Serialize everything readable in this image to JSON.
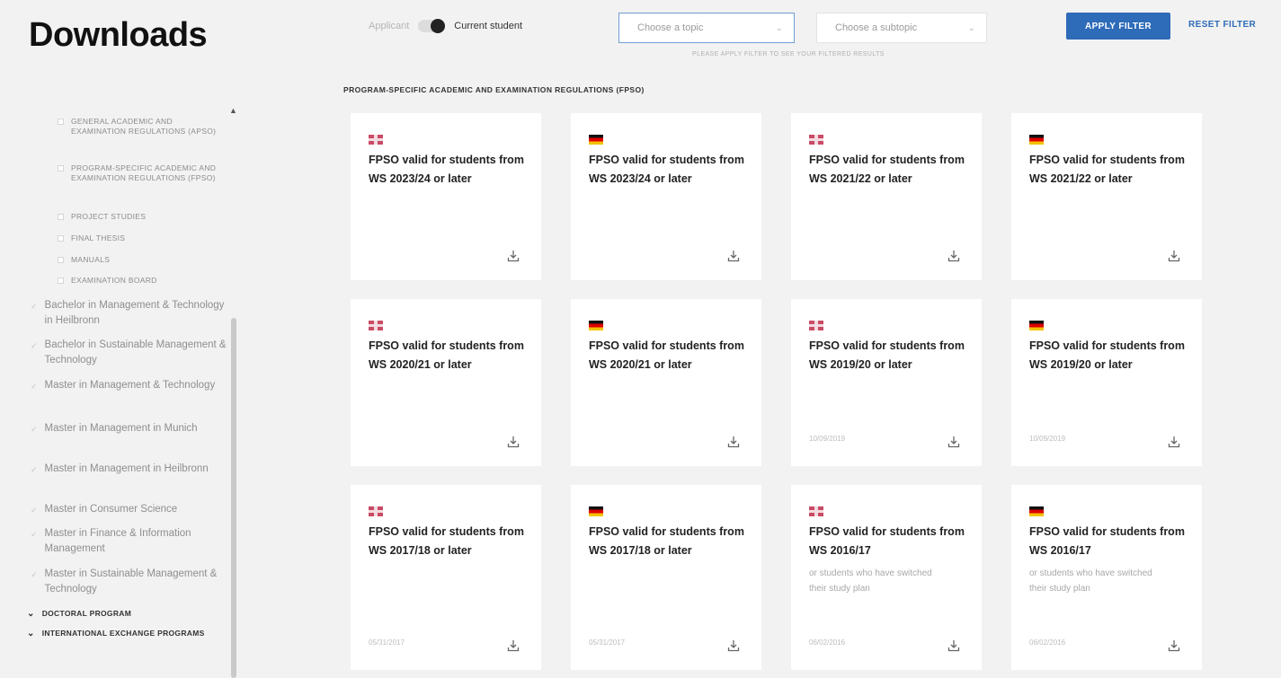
{
  "page": {
    "title": "Downloads"
  },
  "filters": {
    "status_option_off": "Applicant",
    "status_option_on": "Current student",
    "topic_placeholder": "Choose a topic",
    "subtopic_placeholder": "Choose a subtopic",
    "hint": "PLEASE APPLY FILTER TO SEE YOUR FILTERED RESULTS",
    "apply_label": "APPLY FILTER",
    "reset_label": "RESET FILTER"
  },
  "sidebar": {
    "sub_items": [
      {
        "label": "GENERAL ACADEMIC AND EXAMINATION REGULATIONS (APSO)"
      },
      {
        "label": "PROGRAM-SPECIFIC ACADEMIC AND EXAMINATION REGULATIONS (FPSO)"
      },
      {
        "label": "PROJECT STUDIES"
      },
      {
        "label": "FINAL THESIS"
      },
      {
        "label": "MANUALS"
      },
      {
        "label": "EXAMINATION BOARD"
      }
    ],
    "programs": [
      {
        "label": "Bachelor in Management & Technology in Heilbronn"
      },
      {
        "label": "Bachelor in Sustainable Management & Technology"
      },
      {
        "label": "Master in Management & Technology"
      },
      {
        "label": "Master in Management in Munich"
      },
      {
        "label": "Master in Management in Heilbronn"
      },
      {
        "label": "Master in Consumer Science"
      },
      {
        "label": "Master in Finance & Information Management"
      },
      {
        "label": "Master in Sustainable Management & Technology"
      }
    ],
    "sections": [
      {
        "label": "DOCTORAL PROGRAM"
      },
      {
        "label": "INTERNATIONAL EXCHANGE PROGRAMS"
      }
    ]
  },
  "main": {
    "section_heading": "PROGRAM-SPECIFIC ACADEMIC AND EXAMINATION REGULATIONS (FPSO)",
    "cards": [
      {
        "flag": "uk-flag",
        "title": "FPSO valid for students from WS 2023/24 or later",
        "note": "",
        "date": ""
      },
      {
        "flag": "german-flag",
        "title": "FPSO valid for students from WS 2023/24 or later",
        "note": "",
        "date": ""
      },
      {
        "flag": "uk-flag",
        "title": "FPSO valid for students from WS 2021/22 or later",
        "note": "",
        "date": ""
      },
      {
        "flag": "german-flag",
        "title": "FPSO valid for students from WS 2021/22 or later",
        "note": "",
        "date": ""
      },
      {
        "flag": "uk-flag",
        "title": "FPSO valid for students from WS 2020/21 or later",
        "note": "",
        "date": ""
      },
      {
        "flag": "german-flag",
        "title": "FPSO valid for students from WS 2020/21 or later",
        "note": "",
        "date": ""
      },
      {
        "flag": "uk-flag",
        "title": "FPSO valid for students from WS 2019/20 or later",
        "note": "",
        "date": "10/09/2019"
      },
      {
        "flag": "german-flag",
        "title": "FPSO valid for students from WS 2019/20 or later",
        "note": "",
        "date": "10/09/2019"
      },
      {
        "flag": "uk-flag",
        "title": "FPSO valid for students from WS 2017/18 or later",
        "note": "",
        "date": "05/31/2017"
      },
      {
        "flag": "german-flag",
        "title": "FPSO valid for students from WS 2017/18 or later",
        "note": "",
        "date": "05/31/2017"
      },
      {
        "flag": "uk-flag",
        "title": "FPSO valid for students from WS 2016/17",
        "note": "or students who have switched their study plan",
        "date": "06/02/2016"
      },
      {
        "flag": "german-flag",
        "title": "FPSO valid for students from WS 2016/17",
        "note": "or students who have switched their study plan",
        "date": "06/02/2016"
      }
    ]
  },
  "colors": {
    "accent": "#2e6bb8",
    "background": "#f2f2f2"
  }
}
